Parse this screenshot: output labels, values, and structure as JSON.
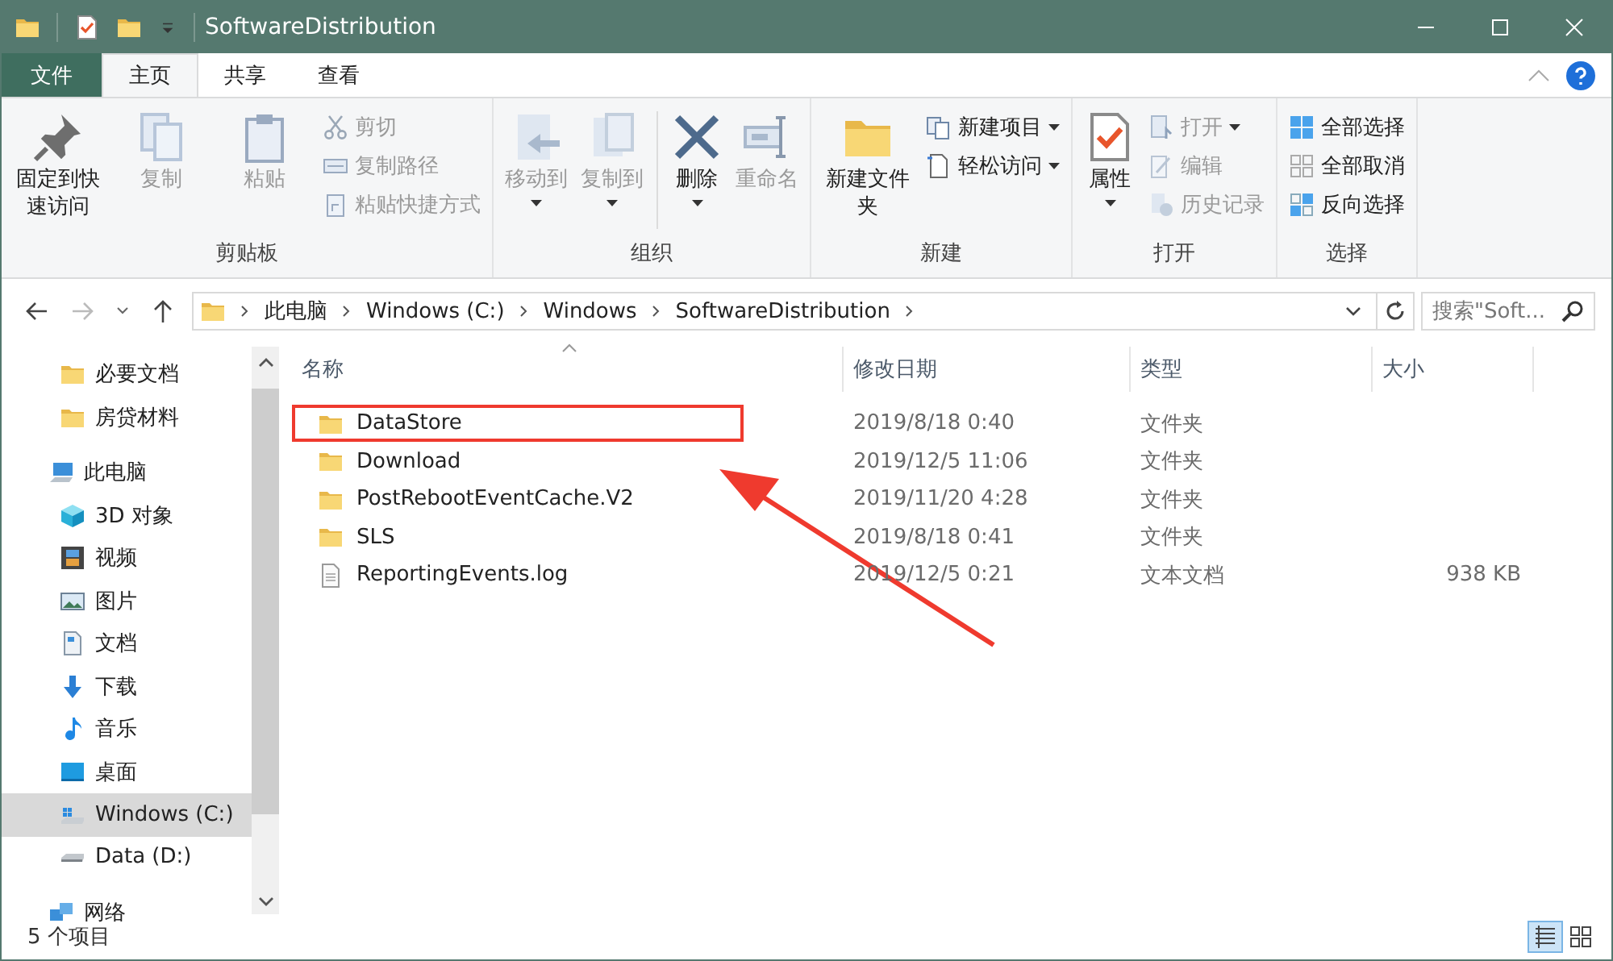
{
  "window": {
    "title": "SoftwareDistribution"
  },
  "ribbon_tabs": [
    {
      "label": "文件",
      "kind": "file",
      "selected": false
    },
    {
      "label": "主页",
      "kind": "tab",
      "selected": true
    },
    {
      "label": "共享",
      "kind": "tab",
      "selected": false
    },
    {
      "label": "查看",
      "kind": "tab",
      "selected": false
    }
  ],
  "ribbon_groups": [
    {
      "label": "剪贴板",
      "items": [
        {
          "kind": "large",
          "label": "固定到快速访问",
          "disabled": false,
          "caret": false
        },
        {
          "kind": "large",
          "label": "复制",
          "disabled": true,
          "caret": false
        },
        {
          "kind": "large",
          "label": "粘贴",
          "disabled": true,
          "caret": false
        },
        {
          "kind": "stack",
          "items": [
            {
              "label": "剪切",
              "disabled": true,
              "caret": false
            },
            {
              "label": "复制路径",
              "disabled": true,
              "caret": false
            },
            {
              "label": "粘贴快捷方式",
              "disabled": true,
              "caret": false
            }
          ]
        }
      ]
    },
    {
      "label": "组织",
      "items": [
        {
          "kind": "large",
          "label": "移动到",
          "disabled": true,
          "caret": true
        },
        {
          "kind": "large",
          "label": "复制到",
          "disabled": true,
          "caret": true
        },
        {
          "kind": "separator"
        },
        {
          "kind": "large",
          "label": "删除",
          "disabled": false,
          "caret": true
        },
        {
          "kind": "large",
          "label": "重命名",
          "disabled": true,
          "caret": false
        }
      ]
    },
    {
      "label": "新建",
      "items": [
        {
          "kind": "large",
          "label": "新建文件夹",
          "disabled": false,
          "caret": false
        },
        {
          "kind": "stack",
          "items": [
            {
              "label": "新建项目",
              "disabled": false,
              "caret": true
            },
            {
              "label": "轻松访问",
              "disabled": false,
              "caret": true
            }
          ]
        }
      ]
    },
    {
      "label": "打开",
      "items": [
        {
          "kind": "large",
          "label": "属性",
          "disabled": false,
          "caret": true
        },
        {
          "kind": "stack",
          "items": [
            {
              "label": "打开",
              "disabled": true,
              "caret": true
            },
            {
              "label": "编辑",
              "disabled": true,
              "caret": false
            },
            {
              "label": "历史记录",
              "disabled": true,
              "caret": false
            }
          ]
        }
      ]
    },
    {
      "label": "选择",
      "items": [
        {
          "kind": "stack",
          "items": [
            {
              "label": "全部选择",
              "disabled": false,
              "caret": false
            },
            {
              "label": "全部取消",
              "disabled": false,
              "caret": false
            },
            {
              "label": "反向选择",
              "disabled": false,
              "caret": false
            }
          ]
        }
      ]
    }
  ],
  "address_bar": {
    "path": [
      "此电脑",
      "Windows (C:)",
      "Windows",
      "SoftwareDistribution"
    ]
  },
  "search": {
    "placeholder": "搜索\"Soft..."
  },
  "sidebar": {
    "pinned": [
      {
        "label": "必要文档",
        "selected": false
      },
      {
        "label": "房贷材料",
        "selected": false
      }
    ],
    "items": [
      {
        "label": "此电脑",
        "selected": false,
        "children": [
          {
            "label": "3D 对象",
            "selected": false
          },
          {
            "label": "视频",
            "selected": false
          },
          {
            "label": "图片",
            "selected": false
          },
          {
            "label": "文档",
            "selected": false
          },
          {
            "label": "下载",
            "selected": false
          },
          {
            "label": "音乐",
            "selected": false
          },
          {
            "label": "桌面",
            "selected": false
          },
          {
            "label": "Windows (C:)",
            "selected": true
          },
          {
            "label": "Data (D:)",
            "selected": false
          }
        ]
      },
      {
        "label": "网络",
        "selected": false
      }
    ]
  },
  "table": {
    "columns": [
      "名称",
      "修改日期",
      "类型",
      "大小"
    ],
    "rows": [
      {
        "name": "DataStore",
        "kind": "folder",
        "modified": "2019/8/18 0:40",
        "type": "文件夹",
        "highlighted": true
      },
      {
        "name": "Download",
        "kind": "folder",
        "modified": "2019/12/5 11:06",
        "type": "文件夹",
        "highlighted": false
      },
      {
        "name": "PostRebootEventCache.V2",
        "kind": "folder",
        "modified": "2019/11/20 4:28",
        "type": "文件夹",
        "highlighted": false
      },
      {
        "name": "SLS",
        "kind": "folder",
        "modified": "2019/8/18 0:41",
        "type": "文件夹",
        "highlighted": false
      },
      {
        "name": "ReportingEvents.log",
        "kind": "file",
        "modified": "2019/12/5 0:21",
        "type": "文本文档",
        "size": "938 KB",
        "highlighted": false
      }
    ]
  },
  "status_bar": {
    "text": "5 个项目",
    "views": [
      {
        "kind": "details",
        "selected": true
      },
      {
        "kind": "large",
        "selected": false
      }
    ]
  }
}
